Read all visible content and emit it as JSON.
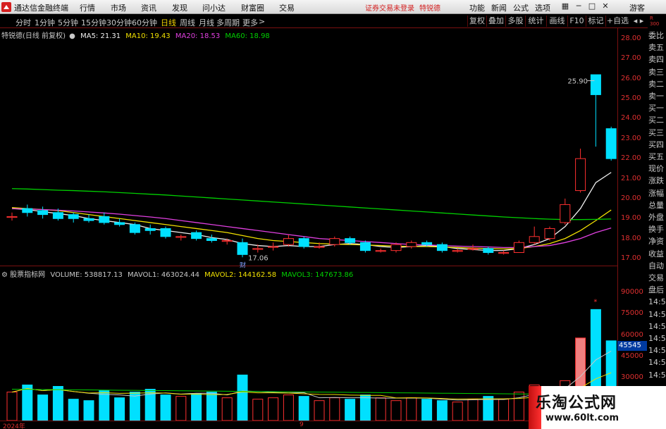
{
  "menubar": {
    "app_title": "通达信金融终端",
    "items": [
      "行情",
      "市场",
      "资讯",
      "发现",
      "问小达",
      "财富圈",
      "交易"
    ],
    "notice": "证券交易未登录",
    "stock_tag": "特锐德",
    "right_items": [
      "功能",
      "新闻",
      "公式",
      "选项"
    ],
    "guest": "游客"
  },
  "toolbar": {
    "periods": [
      "分时",
      "1分钟",
      "5分钟",
      "15分钟",
      "30分钟",
      "60分钟",
      "日线",
      "周线",
      "月线",
      "多周期",
      "更多"
    ],
    "active_period": "日线",
    "right": [
      "复权",
      "叠加",
      "多股",
      "统计",
      "画线",
      "F10",
      "标记",
      "+自选"
    ]
  },
  "price_legend": {
    "name": "特锐德(日线 前复权)",
    "ma5": "MA5: 21.31",
    "ma10": "MA10: 19.43",
    "ma20": "MA20: 18.53",
    "ma60": "MA60: 18.98"
  },
  "volume_legend": {
    "name": "股票指标网",
    "volume": "VOLUME: 538817.13",
    "mavol1": "MAVOL1: 463024.44",
    "mavol2": "MAVOL2: 144162.58",
    "mavol3": "MAVOL3: 147673.86"
  },
  "price_axis": [
    "28.00",
    "27.00",
    "26.00",
    "25.00",
    "24.00",
    "23.00",
    "22.00",
    "21.00",
    "20.00",
    "19.00",
    "18.00",
    "17.00"
  ],
  "volume_axis": [
    "90000",
    "75000",
    "60000",
    "45000",
    "30000"
  ],
  "annotations": {
    "high": "25.90",
    "low": "17.06",
    "fin_tag": "财",
    "cross_marker": "45545"
  },
  "side_panel": [
    "委比",
    "卖五",
    "卖四",
    "卖三",
    "卖二",
    "卖一",
    "买一",
    "买二",
    "买三",
    "买四",
    "买五",
    "现价",
    "涨跌",
    "涨幅",
    "总量",
    "外盘",
    "换手",
    "净资",
    "收益",
    "自动",
    "交易",
    "盘后",
    "14:5",
    "14:5",
    "14:5",
    "14:5",
    "14:5",
    "14:5",
    "14:5"
  ],
  "date_axis": {
    "year": "2024年",
    "mark": "9"
  },
  "watermark": {
    "cn": "乐淘公式网",
    "url": "www.60lt.com"
  },
  "colors": {
    "up": "#ff3030",
    "down": "#00e0ff",
    "ma5": "#f0f0f0",
    "ma10": "#f0e000",
    "ma20": "#e040e0",
    "ma60": "#00d000",
    "axis": "#e03030"
  },
  "chart_data": {
    "type": "candlestick",
    "ylim": [
      17,
      28
    ],
    "candles": [
      {
        "o": 19.1,
        "c": 19.1,
        "h": 19.3,
        "l": 18.9
      },
      {
        "o": 19.5,
        "c": 19.3,
        "h": 19.7,
        "l": 19.1
      },
      {
        "o": 19.4,
        "c": 19.2,
        "h": 19.6,
        "l": 19.0
      },
      {
        "o": 19.3,
        "c": 19.0,
        "h": 19.5,
        "l": 18.9
      },
      {
        "o": 19.2,
        "c": 19.0,
        "h": 19.3,
        "l": 18.8
      },
      {
        "o": 19.0,
        "c": 18.9,
        "h": 19.2,
        "l": 18.8
      },
      {
        "o": 19.1,
        "c": 18.8,
        "h": 19.3,
        "l": 18.7
      },
      {
        "o": 18.8,
        "c": 18.7,
        "h": 19.0,
        "l": 18.6
      },
      {
        "o": 18.7,
        "c": 18.3,
        "h": 18.8,
        "l": 18.2
      },
      {
        "o": 18.5,
        "c": 18.4,
        "h": 18.7,
        "l": 18.2
      },
      {
        "o": 18.5,
        "c": 18.1,
        "h": 18.6,
        "l": 18.0
      },
      {
        "o": 18.1,
        "c": 18.1,
        "h": 18.2,
        "l": 17.9
      },
      {
        "o": 18.3,
        "c": 18.0,
        "h": 18.4,
        "l": 17.9
      },
      {
        "o": 18.0,
        "c": 17.9,
        "h": 18.2,
        "l": 17.8
      },
      {
        "o": 17.9,
        "c": 17.9,
        "h": 18.0,
        "l": 17.7
      },
      {
        "o": 17.8,
        "c": 17.2,
        "h": 18.0,
        "l": 17.06
      },
      {
        "o": 17.5,
        "c": 17.5,
        "h": 17.7,
        "l": 17.3
      },
      {
        "o": 17.6,
        "c": 17.6,
        "h": 17.8,
        "l": 17.4
      },
      {
        "o": 17.7,
        "c": 18.0,
        "h": 18.2,
        "l": 17.6
      },
      {
        "o": 18.0,
        "c": 17.6,
        "h": 18.1,
        "l": 17.5
      },
      {
        "o": 17.6,
        "c": 17.6,
        "h": 17.8,
        "l": 17.5
      },
      {
        "o": 17.7,
        "c": 18.0,
        "h": 18.1,
        "l": 17.6
      },
      {
        "o": 18.0,
        "c": 17.8,
        "h": 18.1,
        "l": 17.7
      },
      {
        "o": 17.8,
        "c": 17.4,
        "h": 17.9,
        "l": 17.3
      },
      {
        "o": 17.4,
        "c": 17.4,
        "h": 17.5,
        "l": 17.3
      },
      {
        "o": 17.4,
        "c": 17.7,
        "h": 17.8,
        "l": 17.3
      },
      {
        "o": 17.6,
        "c": 17.8,
        "h": 17.9,
        "l": 17.5
      },
      {
        "o": 17.8,
        "c": 17.7,
        "h": 17.9,
        "l": 17.6
      },
      {
        "o": 17.7,
        "c": 17.4,
        "h": 17.8,
        "l": 17.3
      },
      {
        "o": 17.4,
        "c": 17.4,
        "h": 17.5,
        "l": 17.3
      },
      {
        "o": 17.5,
        "c": 17.5,
        "h": 17.7,
        "l": 17.4
      },
      {
        "o": 17.5,
        "c": 17.3,
        "h": 17.6,
        "l": 17.2
      },
      {
        "o": 17.3,
        "c": 17.3,
        "h": 17.4,
        "l": 17.2
      },
      {
        "o": 17.3,
        "c": 17.8,
        "h": 17.9,
        "l": 17.3
      },
      {
        "o": 17.8,
        "c": 18.1,
        "h": 18.6,
        "l": 17.7
      },
      {
        "o": 18.0,
        "c": 18.5,
        "h": 18.6,
        "l": 17.9
      },
      {
        "o": 18.8,
        "c": 19.7,
        "h": 20.0,
        "l": 18.7
      },
      {
        "o": 20.4,
        "c": 22.0,
        "h": 22.5,
        "l": 20.3
      },
      {
        "o": 26.2,
        "c": 25.2,
        "h": 25.9,
        "l": 22.6
      },
      {
        "o": 23.5,
        "c": 22.0,
        "h": 23.6,
        "l": 21.9
      }
    ],
    "volumes": [
      20000,
      25000,
      18000,
      24000,
      15000,
      14000,
      21000,
      16000,
      20000,
      22000,
      18000,
      17000,
      19000,
      20000,
      16000,
      32000,
      15000,
      16000,
      18000,
      17000,
      14000,
      16000,
      15000,
      18000,
      16000,
      14000,
      16000,
      15000,
      14000,
      13000,
      15000,
      17000,
      15000,
      20000,
      25000,
      24000,
      28000,
      58000,
      78000,
      56000
    ],
    "series": [
      {
        "name": "MA5",
        "values": [
          19.5,
          19.45,
          19.35,
          19.25,
          19.15,
          19.0,
          18.9,
          18.8,
          18.7,
          18.5,
          18.4,
          18.3,
          18.2,
          18.05,
          17.95,
          17.75,
          17.65,
          17.6,
          17.65,
          17.6,
          17.6,
          17.7,
          17.75,
          17.7,
          17.6,
          17.55,
          17.6,
          17.65,
          17.6,
          17.5,
          17.45,
          17.4,
          17.4,
          17.5,
          17.7,
          18.0,
          18.6,
          19.5,
          20.8,
          21.31
        ]
      },
      {
        "name": "MA10",
        "values": [
          19.55,
          19.5,
          19.45,
          19.4,
          19.3,
          19.2,
          19.1,
          19.0,
          18.9,
          18.8,
          18.7,
          18.6,
          18.5,
          18.4,
          18.3,
          18.15,
          18.0,
          17.9,
          17.85,
          17.8,
          17.75,
          17.72,
          17.7,
          17.68,
          17.65,
          17.62,
          17.6,
          17.6,
          17.58,
          17.55,
          17.52,
          17.5,
          17.48,
          17.5,
          17.6,
          17.75,
          18.0,
          18.4,
          18.9,
          19.43
        ]
      },
      {
        "name": "MA20",
        "values": [
          19.5,
          19.48,
          19.45,
          19.42,
          19.38,
          19.33,
          19.28,
          19.22,
          19.15,
          19.08,
          19.0,
          18.9,
          18.8,
          18.7,
          18.6,
          18.5,
          18.4,
          18.3,
          18.2,
          18.1,
          18.0,
          17.95,
          17.9,
          17.85,
          17.8,
          17.75,
          17.7,
          17.68,
          17.65,
          17.62,
          17.6,
          17.58,
          17.55,
          17.55,
          17.6,
          17.65,
          17.8,
          18.0,
          18.3,
          18.53
        ]
      },
      {
        "name": "MA60",
        "values": [
          20.5,
          20.48,
          20.45,
          20.42,
          20.4,
          20.37,
          20.34,
          20.3,
          20.26,
          20.22,
          20.18,
          20.13,
          20.08,
          20.03,
          19.98,
          19.93,
          19.88,
          19.83,
          19.78,
          19.73,
          19.68,
          19.63,
          19.58,
          19.53,
          19.48,
          19.43,
          19.38,
          19.33,
          19.28,
          19.23,
          19.18,
          19.13,
          19.08,
          19.04,
          19.0,
          18.97,
          18.95,
          18.95,
          18.96,
          18.98
        ]
      }
    ]
  }
}
